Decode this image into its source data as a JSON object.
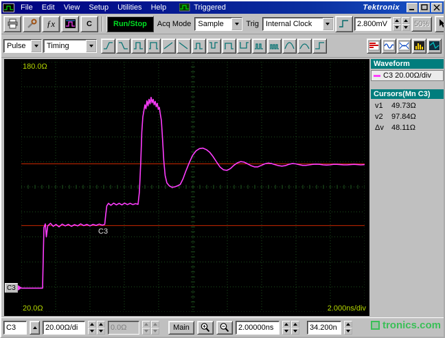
{
  "colors": {
    "trace": "#ff3dff",
    "cursor": "#cc2800",
    "grid": "#1e521e",
    "scale_text": "#b5d800",
    "header_teal": "#007d7d",
    "title_blue": "#000080"
  },
  "window": {
    "menus": [
      "File",
      "Edit",
      "View",
      "Setup",
      "Utilities",
      "Help"
    ],
    "trigger_status": "Triggered",
    "brand": "Tektronix"
  },
  "toolbar": {
    "fx_label": "ƒx",
    "c_button": "C",
    "run_stop": "Run/Stop",
    "acq_mode_label": "Acq Mode",
    "acq_mode_value": "Sample",
    "trig_label": "Trig",
    "trig_value": "Internal Clock",
    "trigger_level": "2.800mV",
    "intensity": "50%",
    "icons": [
      "print",
      "tools",
      "formula",
      "waveform-display",
      "compensation",
      "slope",
      "help-pointer"
    ]
  },
  "toolbar2": {
    "pulse": "Pulse",
    "timing": "Timing",
    "shape_buttons": [
      "edge-rise",
      "edge-fall",
      "pulse-pos",
      "pulse-pos-wide",
      "ramp-rise",
      "ramp-fall",
      "pulse-up",
      "pulse-down",
      "pulse-up-wide",
      "pulse-down-wide",
      "double-pulse",
      "pulse-train",
      "gauss-pulse",
      "gauss-wide",
      "step-pulse"
    ],
    "analysis_buttons": [
      "histogram-red",
      "waveform-blue",
      "eye-diagram",
      "histogram-yellow",
      "mask-test"
    ]
  },
  "display": {
    "top_scale": "180.0Ω",
    "bottom_scale": "20.0Ω",
    "time_scale": "2.000ns/div",
    "trace_label": "C3",
    "channel_marker": "C3"
  },
  "side_panel": {
    "waveform_header": "Waveform",
    "waveform_entry": "C3 20.00Ω/div",
    "cursors_header": "Cursors(Mn C3)",
    "readouts": [
      {
        "label": "v1",
        "value": "49.73Ω"
      },
      {
        "label": "v2",
        "value": "97.84Ω"
      },
      {
        "label": "Δv",
        "value": "48.11Ω"
      }
    ]
  },
  "status_bar": {
    "channel": "C3",
    "vertical_scale": "20.00Ω/di",
    "offset": "0.0Ω",
    "main_label": "Main",
    "horizontal_scale": "2.00000ns",
    "position": "34.200n"
  },
  "watermark": "tronics.com",
  "chart_data": {
    "type": "line",
    "series": [
      {
        "name": "C3",
        "color": "#ff3dff"
      }
    ],
    "x_divisions": 10,
    "y_divisions": 10,
    "time_per_div_ns": 2.0,
    "ohms_per_div": 20.0,
    "top_label_ohms": 180.0,
    "bottom_label_ohms": 20.0,
    "cursors": {
      "v1_ohms": 49.73,
      "v2_ohms": 97.84,
      "dv_ohms": 48.11
    },
    "cursor_fracs": [
      0.408,
      0.655
    ],
    "points_norm": [
      [
        0.0,
        0.905
      ],
      [
        0.062,
        0.905
      ],
      [
        0.064,
        0.78
      ],
      [
        0.066,
        0.662
      ],
      [
        0.07,
        0.648
      ],
      [
        0.073,
        0.7
      ],
      [
        0.077,
        0.656
      ],
      [
        0.085,
        0.646
      ],
      [
        0.093,
        0.658
      ],
      [
        0.101,
        0.65
      ],
      [
        0.11,
        0.66
      ],
      [
        0.119,
        0.649
      ],
      [
        0.128,
        0.656
      ],
      [
        0.137,
        0.65
      ],
      [
        0.146,
        0.658
      ],
      [
        0.155,
        0.651
      ],
      [
        0.164,
        0.656
      ],
      [
        0.173,
        0.648
      ],
      [
        0.182,
        0.655
      ],
      [
        0.191,
        0.65
      ],
      [
        0.2,
        0.656
      ],
      [
        0.209,
        0.65
      ],
      [
        0.218,
        0.654
      ],
      [
        0.227,
        0.649
      ],
      [
        0.236,
        0.653
      ],
      [
        0.243,
        0.65
      ],
      [
        0.246,
        0.61
      ],
      [
        0.249,
        0.576
      ],
      [
        0.254,
        0.566
      ],
      [
        0.261,
        0.574
      ],
      [
        0.269,
        0.565
      ],
      [
        0.277,
        0.572
      ],
      [
        0.285,
        0.566
      ],
      [
        0.293,
        0.572
      ],
      [
        0.301,
        0.565
      ],
      [
        0.309,
        0.571
      ],
      [
        0.317,
        0.566
      ],
      [
        0.325,
        0.571
      ],
      [
        0.333,
        0.567
      ],
      [
        0.34,
        0.57
      ],
      [
        0.344,
        0.52
      ],
      [
        0.348,
        0.4
      ],
      [
        0.351,
        0.28
      ],
      [
        0.354,
        0.22
      ],
      [
        0.357,
        0.196
      ],
      [
        0.36,
        0.172
      ],
      [
        0.363,
        0.188
      ],
      [
        0.366,
        0.156
      ],
      [
        0.369,
        0.176
      ],
      [
        0.372,
        0.15
      ],
      [
        0.375,
        0.168
      ],
      [
        0.378,
        0.142
      ],
      [
        0.381,
        0.164
      ],
      [
        0.384,
        0.15
      ],
      [
        0.387,
        0.172
      ],
      [
        0.39,
        0.158
      ],
      [
        0.393,
        0.18
      ],
      [
        0.396,
        0.166
      ],
      [
        0.399,
        0.19
      ],
      [
        0.402,
        0.182
      ],
      [
        0.405,
        0.21
      ],
      [
        0.408,
        0.235
      ],
      [
        0.411,
        0.3
      ],
      [
        0.415,
        0.395
      ],
      [
        0.419,
        0.455
      ],
      [
        0.424,
        0.484
      ],
      [
        0.431,
        0.496
      ],
      [
        0.439,
        0.502
      ],
      [
        0.447,
        0.5
      ],
      [
        0.455,
        0.496
      ],
      [
        0.463,
        0.49
      ],
      [
        0.471,
        0.468
      ],
      [
        0.479,
        0.438
      ],
      [
        0.489,
        0.404
      ],
      [
        0.499,
        0.374
      ],
      [
        0.509,
        0.356
      ],
      [
        0.519,
        0.347
      ],
      [
        0.529,
        0.345
      ],
      [
        0.539,
        0.351
      ],
      [
        0.549,
        0.362
      ],
      [
        0.559,
        0.38
      ],
      [
        0.569,
        0.401
      ],
      [
        0.579,
        0.421
      ],
      [
        0.589,
        0.432
      ],
      [
        0.599,
        0.434
      ],
      [
        0.609,
        0.427
      ],
      [
        0.619,
        0.414
      ],
      [
        0.629,
        0.404
      ],
      [
        0.639,
        0.399
      ],
      [
        0.649,
        0.401
      ],
      [
        0.659,
        0.408
      ],
      [
        0.669,
        0.415
      ],
      [
        0.679,
        0.42
      ],
      [
        0.689,
        0.42
      ],
      [
        0.699,
        0.414
      ],
      [
        0.709,
        0.408
      ],
      [
        0.719,
        0.405
      ],
      [
        0.729,
        0.407
      ],
      [
        0.739,
        0.411
      ],
      [
        0.749,
        0.415
      ],
      [
        0.759,
        0.417
      ],
      [
        0.769,
        0.415
      ],
      [
        0.779,
        0.41
      ],
      [
        0.789,
        0.407
      ],
      [
        0.799,
        0.408
      ],
      [
        0.809,
        0.411
      ],
      [
        0.819,
        0.414
      ],
      [
        0.829,
        0.414
      ],
      [
        0.839,
        0.412
      ],
      [
        0.849,
        0.41
      ],
      [
        0.859,
        0.409
      ],
      [
        0.869,
        0.41
      ],
      [
        0.879,
        0.412
      ],
      [
        0.889,
        0.413
      ],
      [
        0.899,
        0.412
      ],
      [
        0.909,
        0.41
      ],
      [
        0.919,
        0.41
      ],
      [
        0.929,
        0.411
      ],
      [
        0.939,
        0.412
      ],
      [
        0.949,
        0.412
      ],
      [
        0.959,
        0.411
      ],
      [
        0.969,
        0.41
      ],
      [
        0.979,
        0.411
      ],
      [
        0.989,
        0.412
      ],
      [
        1.0,
        0.411
      ]
    ]
  }
}
